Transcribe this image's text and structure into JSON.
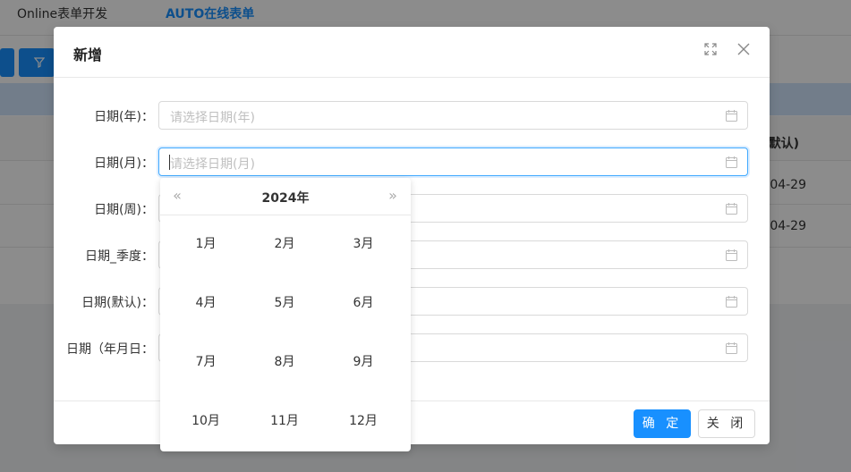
{
  "background": {
    "tabs": [
      "Online表单开发",
      "AUTO在线表单"
    ],
    "column_header_fragment": "默认)",
    "row_values": [
      "04-29",
      "04-29"
    ]
  },
  "modal": {
    "title": "新增",
    "icons": [
      "fullscreen-icon",
      "close-icon"
    ],
    "fields": [
      {
        "label": "日期(年)：",
        "placeholder": "请选择日期(年)"
      },
      {
        "label": "日期(月)：",
        "placeholder": "请选择日期(月)",
        "focused": true
      },
      {
        "label": "日期(周)：",
        "placeholder": ""
      },
      {
        "label": "日期_季度：",
        "placeholder": ""
      },
      {
        "label": "日期(默认)：",
        "placeholder": ""
      },
      {
        "label": "日期（年月日：",
        "placeholder": ""
      }
    ],
    "footer": {
      "confirm_label": "确 定",
      "close_label": "关 闭"
    }
  },
  "month_picker": {
    "year": "2024年",
    "prev_year_symbol": "«",
    "next_year_symbol": "»",
    "months": [
      "1月",
      "2月",
      "3月",
      "4月",
      "5月",
      "6月",
      "7月",
      "8月",
      "9月",
      "10月",
      "11月",
      "12月"
    ]
  },
  "colors": {
    "primary": "#1890ff",
    "overlay": "rgba(0,0,0,0.45)"
  }
}
